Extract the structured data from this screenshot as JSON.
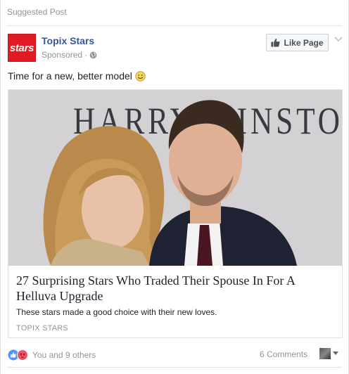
{
  "header": {
    "suggested_label": "Suggested Post"
  },
  "page": {
    "name": "Topix Stars",
    "avatar_text": "stars",
    "sponsored_label": "Sponsored",
    "separator": "·",
    "like_button_label": "Like Page"
  },
  "post": {
    "text": "Time for a new, better model"
  },
  "link": {
    "image_sign_text": "HARRY WINSTON",
    "title": "27 Surprising Stars Who Traded Their Spouse In For A Helluva Upgrade",
    "description": "These stars made a good choice with their new loves.",
    "source": "TOPIX STARS"
  },
  "footer": {
    "reactions_text": "You and 9 others",
    "comments_text": "6 Comments"
  },
  "colors": {
    "link_blue": "#365899",
    "brand_red": "#e11b22",
    "meta_gray": "#90949c"
  },
  "icons": [
    "globe-icon",
    "thumbs-up-icon",
    "chevron-down-icon",
    "smile-emoji-icon",
    "like-reaction-icon",
    "angry-reaction-icon"
  ]
}
